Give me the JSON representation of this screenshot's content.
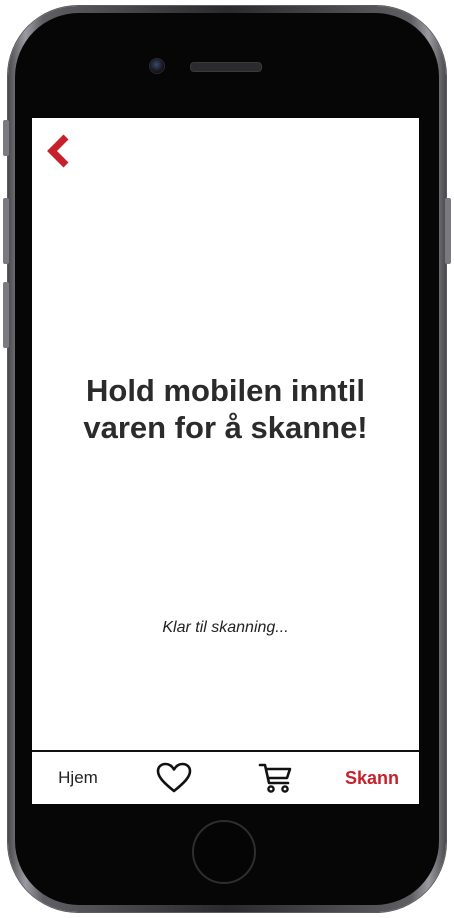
{
  "screen": {
    "title_line1": "Hold mobilen inntil",
    "title_line2": "varen for å skanne!",
    "status_text": "Klar til skanning..."
  },
  "nav": {
    "back_icon": "chevron-left-icon",
    "tabs": [
      {
        "label": "Hjem"
      },
      {
        "icon": "heart-icon"
      },
      {
        "icon": "cart-icon"
      },
      {
        "label": "Skann",
        "active": true
      }
    ]
  },
  "colors": {
    "accent": "#c8202a",
    "text": "#2b2b2b",
    "phone_frame": "#060606"
  }
}
